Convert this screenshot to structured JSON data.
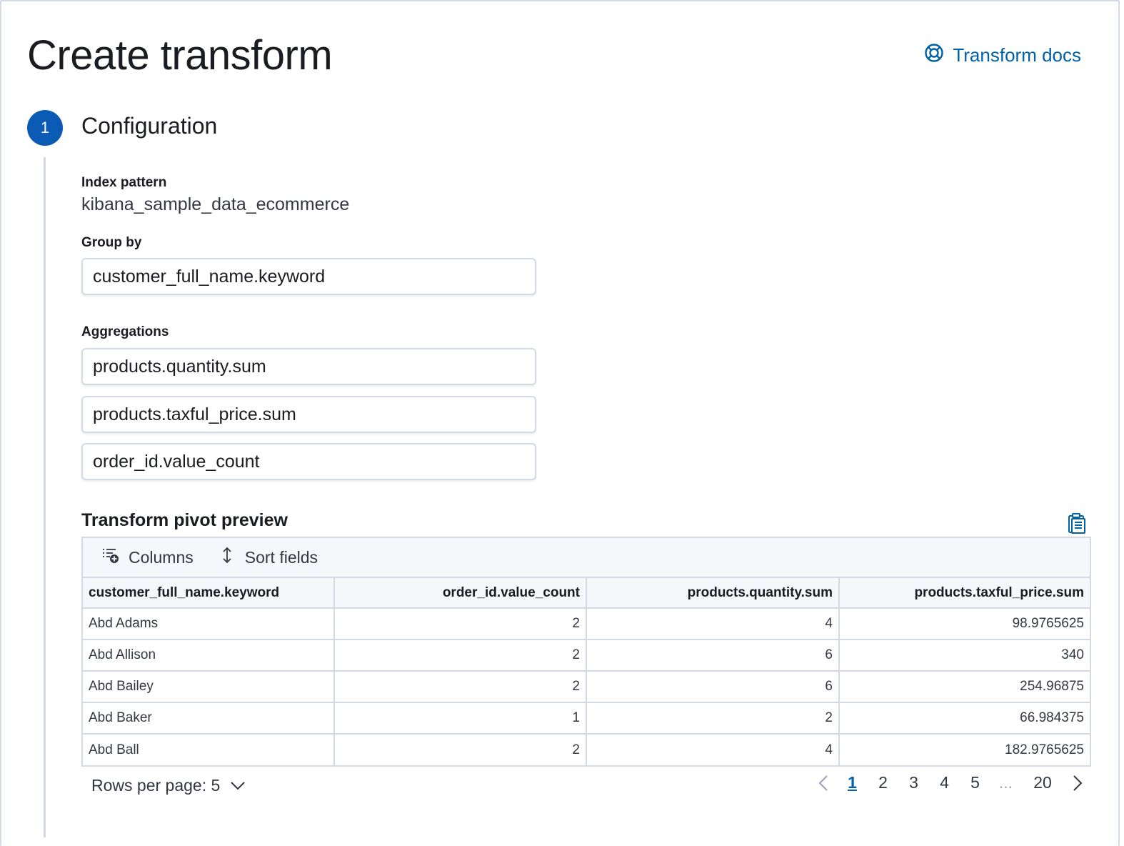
{
  "header": {
    "title": "Create transform",
    "docs_link": "Transform docs"
  },
  "step": {
    "number": "1",
    "title": "Configuration"
  },
  "index_pattern": {
    "label": "Index pattern",
    "value": "kibana_sample_data_ecommerce"
  },
  "group_by": {
    "label": "Group by",
    "value": "customer_full_name.keyword"
  },
  "aggregations": {
    "label": "Aggregations",
    "items": [
      "products.quantity.sum",
      "products.taxful_price.sum",
      "order_id.value_count"
    ]
  },
  "preview": {
    "title": "Transform pivot preview",
    "toolbar": {
      "columns_label": "Columns",
      "sort_label": "Sort fields"
    },
    "columns": [
      "customer_full_name.keyword",
      "order_id.value_count",
      "products.quantity.sum",
      "products.taxful_price.sum"
    ],
    "rows": [
      [
        "Abd Adams",
        "2",
        "4",
        "98.9765625"
      ],
      [
        "Abd Allison",
        "2",
        "6",
        "340"
      ],
      [
        "Abd Bailey",
        "2",
        "6",
        "254.96875"
      ],
      [
        "Abd Baker",
        "1",
        "2",
        "66.984375"
      ],
      [
        "Abd Ball",
        "2",
        "4",
        "182.9765625"
      ]
    ]
  },
  "pagination": {
    "rows_per_page": "Rows per page: 5",
    "pages": [
      "1",
      "2",
      "3",
      "4",
      "5"
    ],
    "ellipsis": "...",
    "last_page": "20",
    "active_page": "1"
  },
  "colors": {
    "accent": "#0061a6",
    "step_badge": "#0b5bb5",
    "border": "#d3dae6"
  }
}
